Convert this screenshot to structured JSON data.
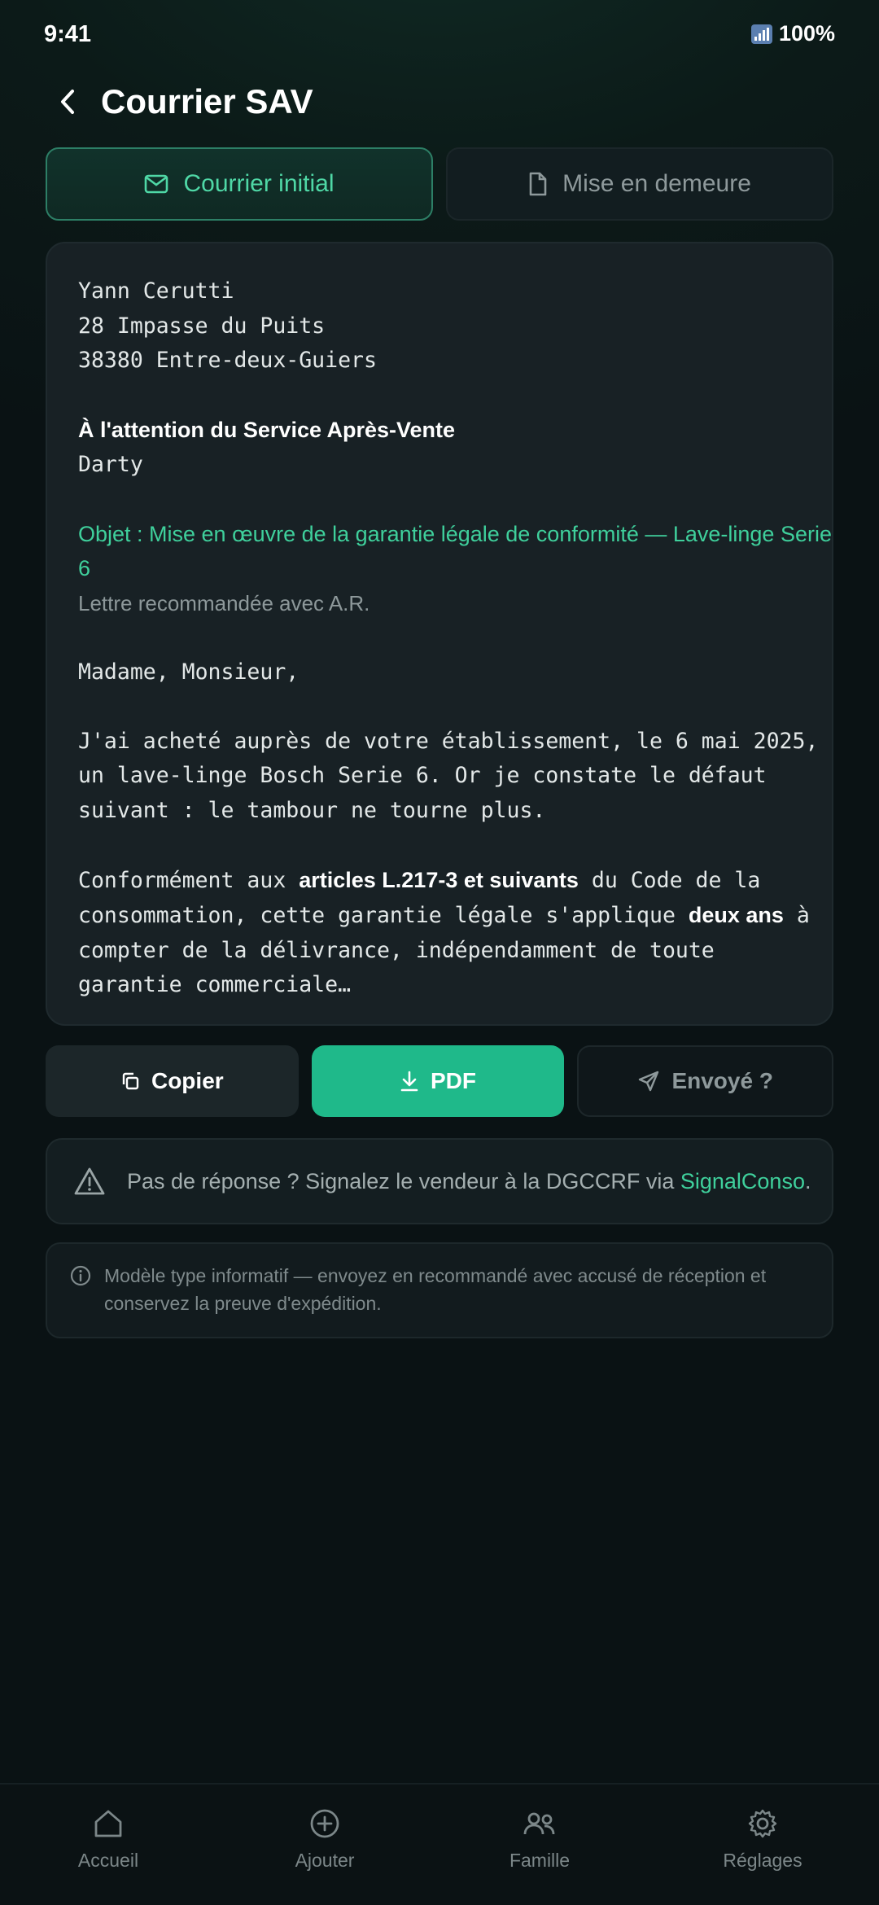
{
  "status": {
    "time": "9:41",
    "battery": "100%"
  },
  "header": {
    "title": "Courrier SAV"
  },
  "tabs": [
    {
      "label": "Courrier initial",
      "active": true
    },
    {
      "label": "Mise en demeure",
      "active": false
    }
  ],
  "letter": {
    "sender_name": "Yann Cerutti",
    "sender_street": "28 Impasse du Puits",
    "sender_city": "38380 Entre-deux-Guiers",
    "attention": "À l'attention du Service Après-Vente",
    "recipient": "Darty",
    "objet_line1": "Objet : Mise en œuvre de la garantie légale de conformité — Lave-linge Serie",
    "objet_line2": "6",
    "recommande": "Lettre recommandée avec A.R.",
    "greeting": "Madame, Monsieur,",
    "para1_line1": "J'ai acheté auprès de votre établissement, le 6 mai 2025,",
    "para1_line2": "un lave-linge Bosch Serie 6. Or je constate le défaut",
    "para1_line3": "suivant : le tambour ne tourne plus.",
    "para2_a": "Conformément aux ",
    "para2_bold1": "articles L.217-3 et suivants",
    "para2_b": " du Code de la",
    "para2_c": "consommation, cette garantie légale s'applique ",
    "para2_bold2": "deux ans",
    "para2_d": " à",
    "para2_line3": "compter de la délivrance, indépendamment de toute",
    "para2_line4": "garantie commerciale…"
  },
  "actions": {
    "copy": "Copier",
    "pdf": "PDF",
    "sent": "Envoyé ?"
  },
  "alert": {
    "text": "Pas de réponse ? Signalez le vendeur à la DGCCRF via ",
    "link": "SignalConso",
    "suffix": "."
  },
  "note": {
    "text": "Modèle type informatif — envoyez en recommandé avec accusé de réception et conservez la preuve d'expédition."
  },
  "nav": [
    {
      "label": "Accueil",
      "icon": "home-icon"
    },
    {
      "label": "Ajouter",
      "icon": "add-circle-icon"
    },
    {
      "label": "Famille",
      "icon": "people-icon"
    },
    {
      "label": "Réglages",
      "icon": "gear-icon"
    }
  ],
  "colors": {
    "accent": "#1fb98a",
    "accent_text": "#3fd09c",
    "background": "#0b1416"
  }
}
